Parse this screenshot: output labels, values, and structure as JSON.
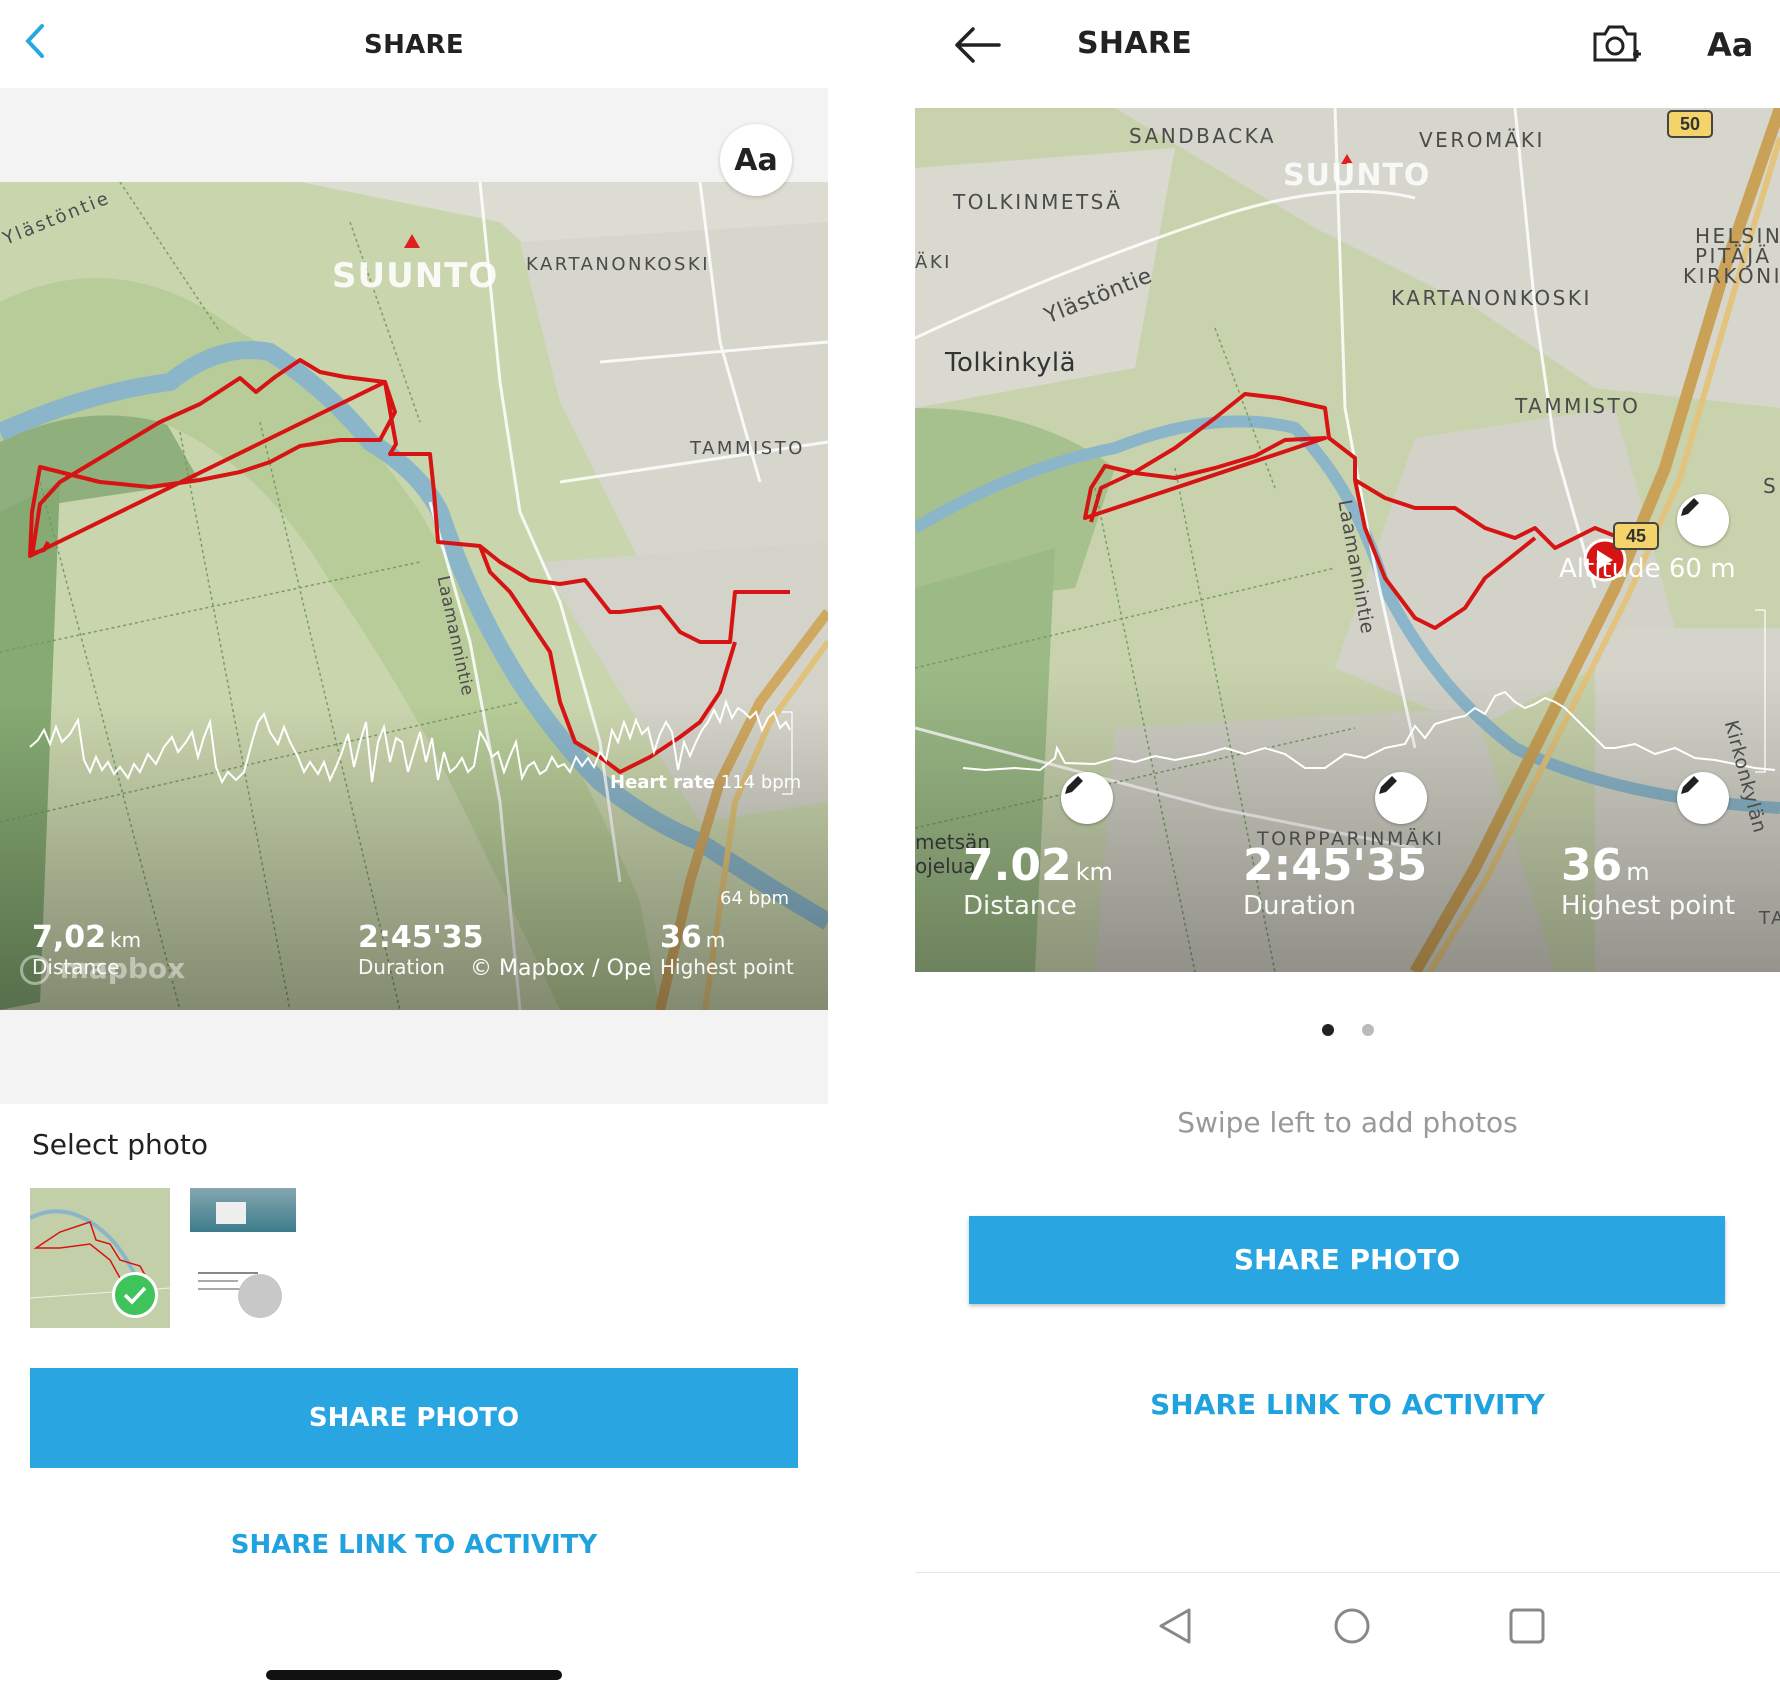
{
  "left": {
    "header": {
      "title": "SHARE"
    },
    "map": {
      "font_button": "Aa",
      "brand": "SUUNTO",
      "places": [
        "Ylästöntie",
        "KARTANONKOSKI",
        "TAMMISTO",
        "Laamannintie"
      ],
      "chart_label": "Heart rate",
      "chart_max": "114 bpm",
      "chart_min": "64 bpm",
      "stats": [
        {
          "value": "7,02",
          "unit": "km",
          "label": "Distance"
        },
        {
          "value": "2:45'35",
          "unit": "",
          "label": "Duration"
        },
        {
          "value": "36",
          "unit": "m",
          "label": "Highest point"
        }
      ],
      "attribution_logo": "mapbox",
      "attribution": "© Mapbox / Ope"
    },
    "select_photo": {
      "title": "Select photo"
    },
    "share_photo": "SHARE PHOTO",
    "share_link": "SHARE LINK TO ACTIVITY"
  },
  "right": {
    "header": {
      "title": "SHARE",
      "font_button": "Aa"
    },
    "map": {
      "brand": "SUUNTO",
      "places": [
        "SANDBACKA",
        "VEROMÄKI",
        "TOLKINMETSÄ",
        "Ylästöntie",
        "Tolkinkylä",
        "KARTANONKOSKI",
        "TAMMISTO",
        "HELSIN",
        "PITÄJÄ",
        "KIRKONI",
        "Laamannintie",
        "TORPPARINMÄKI",
        "Kirkonkylän",
        "ÄKI",
        "metsän",
        "ojelua",
        "TA",
        "S"
      ],
      "road_badges": [
        "50",
        "45"
      ],
      "altitude_label": "Altitude",
      "altitude_value": "60 m",
      "stats": [
        {
          "value": "7.02",
          "unit": "km",
          "label": "Distance"
        },
        {
          "value": "2:45'35",
          "unit": "",
          "label": "Duration"
        },
        {
          "value": "36",
          "unit": "m",
          "label": "Highest point"
        }
      ]
    },
    "pager": {
      "count": 2,
      "active": 1
    },
    "hint": "Swipe left to add photos",
    "share_photo": "SHARE PHOTO",
    "share_link": "SHARE LINK TO ACTIVITY"
  },
  "colors": {
    "accent": "#29a6e1",
    "link": "#1fa2dd",
    "route": "#d71414"
  }
}
